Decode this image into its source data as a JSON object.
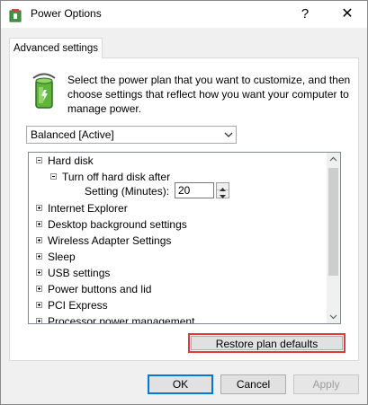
{
  "window": {
    "title": "Power Options",
    "help_glyph": "?",
    "close_glyph": "✕",
    "app_icon": "power-options-icon"
  },
  "tab": {
    "label": "Advanced settings"
  },
  "description": "Select the power plan that you want to customize, and then choose settings that reflect how you want your computer to manage power.",
  "plan_select": {
    "value": "Balanced [Active]"
  },
  "tree": {
    "items": [
      {
        "label": "Hard disk",
        "expanded": true
      },
      {
        "label": "Turn off hard disk after",
        "expanded": true
      },
      {
        "label": "Internet Explorer",
        "expanded": false
      },
      {
        "label": "Desktop background settings",
        "expanded": false
      },
      {
        "label": "Wireless Adapter Settings",
        "expanded": false
      },
      {
        "label": "Sleep",
        "expanded": false
      },
      {
        "label": "USB settings",
        "expanded": false
      },
      {
        "label": "Power buttons and lid",
        "expanded": false
      },
      {
        "label": "PCI Express",
        "expanded": false
      },
      {
        "label": "Processor power management",
        "expanded": false
      }
    ],
    "setting": {
      "label": "Setting (Minutes):",
      "value": "20"
    }
  },
  "buttons": {
    "restore": "Restore plan defaults",
    "ok": "OK",
    "cancel": "Cancel",
    "apply": "Apply"
  },
  "colors": {
    "highlight_border": "#e03a3a",
    "default_button_border": "#0078d7"
  }
}
